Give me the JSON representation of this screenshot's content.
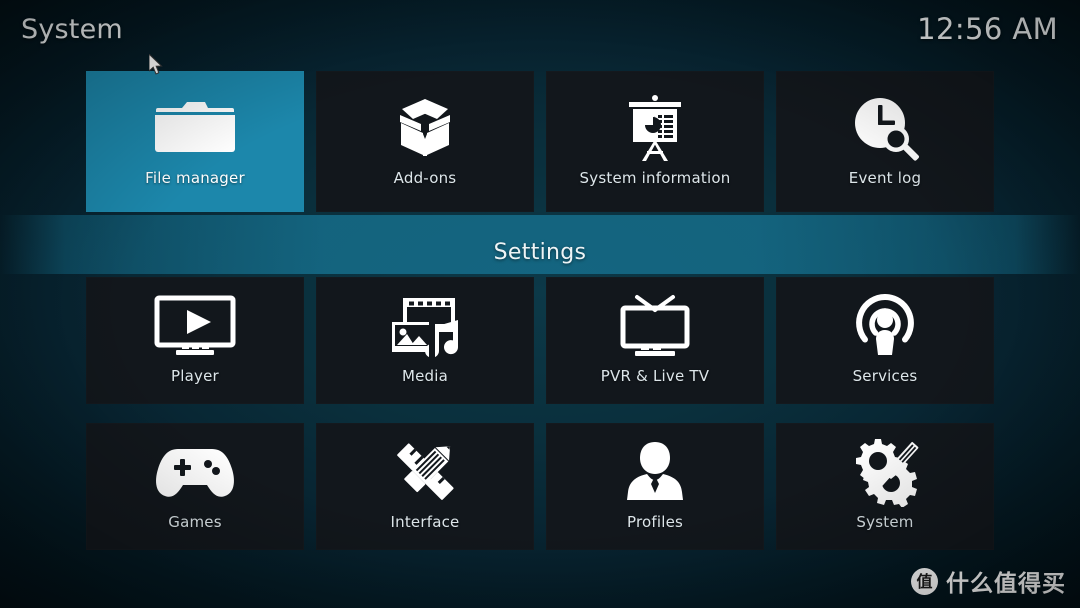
{
  "header": {
    "title": "System",
    "clock": "12:56 AM"
  },
  "section_label": "Settings",
  "colors": {
    "selection": "#1c87ab",
    "tile": "#12171c",
    "band": "#16708e",
    "text": "#dde6ea"
  },
  "top_row": [
    {
      "label": "File manager",
      "icon": "folder-icon",
      "selected": true
    },
    {
      "label": "Add-ons",
      "icon": "open-box-icon",
      "selected": false
    },
    {
      "label": "System information",
      "icon": "presentation-board-icon",
      "selected": false
    },
    {
      "label": "Event log",
      "icon": "clock-search-icon",
      "selected": false
    }
  ],
  "settings_rows": [
    [
      {
        "label": "Player",
        "icon": "monitor-play-icon"
      },
      {
        "label": "Media",
        "icon": "filmstrip-photo-music-icon"
      },
      {
        "label": "PVR & Live TV",
        "icon": "tv-antenna-icon"
      },
      {
        "label": "Services",
        "icon": "podcast-person-icon"
      }
    ],
    [
      {
        "label": "Games",
        "icon": "gamepad-icon"
      },
      {
        "label": "Interface",
        "icon": "pencil-ruler-icon"
      },
      {
        "label": "Profiles",
        "icon": "user-bust-icon"
      },
      {
        "label": "System",
        "icon": "gears-tool-icon"
      }
    ]
  ],
  "watermark": {
    "badge": "值",
    "text": "什么值得买"
  }
}
